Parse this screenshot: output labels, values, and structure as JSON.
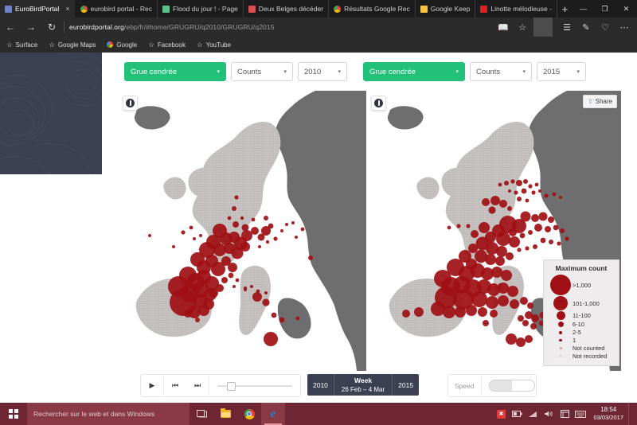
{
  "browser": {
    "tabs": [
      {
        "title": "EuroBirdPortal",
        "active": true,
        "favicon_color": "#6f85c9",
        "close_label": "×"
      },
      {
        "title": "eurobird portal - Rec",
        "active": false,
        "favicon_color": "chrome"
      },
      {
        "title": "Flood du jour ! - Page",
        "active": false,
        "favicon_color": "#5cc08a"
      },
      {
        "title": "Deux Belges décéder",
        "active": false,
        "favicon_color": "#d94f4f"
      },
      {
        "title": "Résultats Google Rec",
        "active": false,
        "favicon_color": "chrome"
      },
      {
        "title": "Google Keep",
        "active": false,
        "favicon_color": "#f6c445"
      },
      {
        "title": "Linotte mélodieuse -",
        "active": false,
        "favicon_color": "#e02020"
      }
    ],
    "new_tab_label": "+",
    "window_controls": {
      "minimize": "—",
      "maximize": "❐",
      "close": "✕"
    },
    "nav": {
      "back": "←",
      "forward": "→",
      "refresh": "↻"
    },
    "url": {
      "host": "eurobirdportal.org",
      "path": "/ebp/fr/#home/GRUGRU/q2010/GRUGRU/q2015"
    },
    "toolbar_icons": [
      "reading-list",
      "favorite-star",
      "hub",
      "web-note",
      "share",
      "more"
    ],
    "bookmarks": [
      {
        "label": "Surface",
        "icon": "star"
      },
      {
        "label": "Google Maps",
        "icon": "star"
      },
      {
        "label": "Google",
        "icon": "google"
      },
      {
        "label": "Facebook",
        "icon": "star"
      },
      {
        "label": "YouTube",
        "icon": "star"
      }
    ]
  },
  "page": {
    "left_panel": {
      "species": "Grue cendrée",
      "metric": "Counts",
      "year": "2010",
      "caret": "▾",
      "download_title": "download"
    },
    "right_panel": {
      "species": "Grue cendrée",
      "metric": "Counts",
      "year": "2015",
      "caret": "▾",
      "download_title": "download",
      "share_label": "Share",
      "share_icon": "⇧"
    },
    "legend": {
      "title": "Maximum count",
      "items": [
        {
          "label": ">1,000",
          "radius": 13,
          "tone": "solid"
        },
        {
          "label": "101-1,000",
          "radius": 9,
          "tone": "solid"
        },
        {
          "label": "11-100",
          "radius": 5.5,
          "tone": "solid"
        },
        {
          "label": "6-10",
          "radius": 3.6,
          "tone": "solid"
        },
        {
          "label": "2-5",
          "radius": 2.1,
          "tone": "solid"
        },
        {
          "label": "1",
          "radius": 1.6,
          "tone": "solid"
        },
        {
          "label": "Not counted",
          "radius": 1.4,
          "tone": "faint"
        },
        {
          "label": "Not recorded",
          "radius": 1.2,
          "tone": "faintest"
        }
      ]
    },
    "player": {
      "play_label": "▶",
      "prev_label": "⏮",
      "next_label": "⏭",
      "progress_percent": 8
    },
    "week": {
      "start_year": "2010",
      "title": "Week",
      "range": "26 Feb – 4 Mar",
      "end_year": "2015"
    },
    "speed": {
      "label": "Speed",
      "position_percent": 50
    },
    "colors": {
      "accent_green": "#22c179",
      "dot_red": "#a00f14",
      "panel_dark": "#3b4052",
      "map_land": "#c9c4c3",
      "map_outside": "#6e6e6e"
    }
  },
  "taskbar": {
    "search_placeholder": "Rechercher sur le web et dans Windows",
    "buttons": [
      "task-view",
      "file-explorer",
      "chrome",
      "edge"
    ],
    "tray": [
      "antivirus",
      "battery",
      "wifi",
      "volume",
      "action-center",
      "keyboard"
    ],
    "time": "18:54",
    "date": "03/03/2017"
  }
}
